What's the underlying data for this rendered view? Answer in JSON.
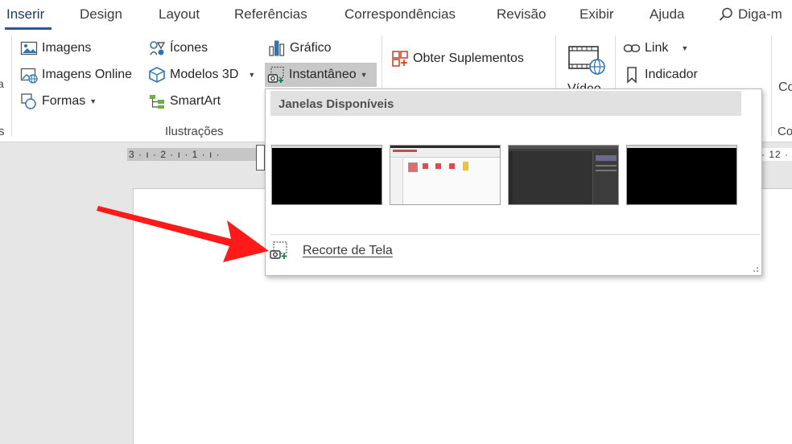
{
  "tabs": [
    {
      "label": "Inserir",
      "active": true
    },
    {
      "label": "Design"
    },
    {
      "label": "Layout"
    },
    {
      "label": "Referências"
    },
    {
      "label": "Correspondências"
    },
    {
      "label": "Revisão"
    },
    {
      "label": "Exibir"
    },
    {
      "label": "Ajuda"
    }
  ],
  "search": {
    "text": "Diga-m",
    "icon": "search-icon"
  },
  "ribbon": {
    "illustrations": {
      "images": "Imagens",
      "online_images": "Imagens Online",
      "shapes": "Formas",
      "icons": "Ícones",
      "models_3d": "Modelos 3D",
      "smartart": "SmartArt",
      "chart": "Gráfico",
      "screenshot": "Instantâneo",
      "group_label": "Ilustrações"
    },
    "addins": {
      "get_addins": "Obter Suplementos"
    },
    "media": {
      "video": "Vídeo"
    },
    "links": {
      "link": "Link",
      "bookmark": "Indicador"
    },
    "partial_group": {
      "label_top": "Co",
      "label_bottom": "Co"
    }
  },
  "ruler": {
    "left_marks": "3 · ı · 2 · ı · 1 · ı ·",
    "right_marks": "· 12 ·"
  },
  "screenshot_menu": {
    "header": "Janelas Disponíveis",
    "clipping": "Recorte de Tela"
  },
  "colors": {
    "accent": "#2b579a",
    "arrow": "#ff1a1a"
  }
}
